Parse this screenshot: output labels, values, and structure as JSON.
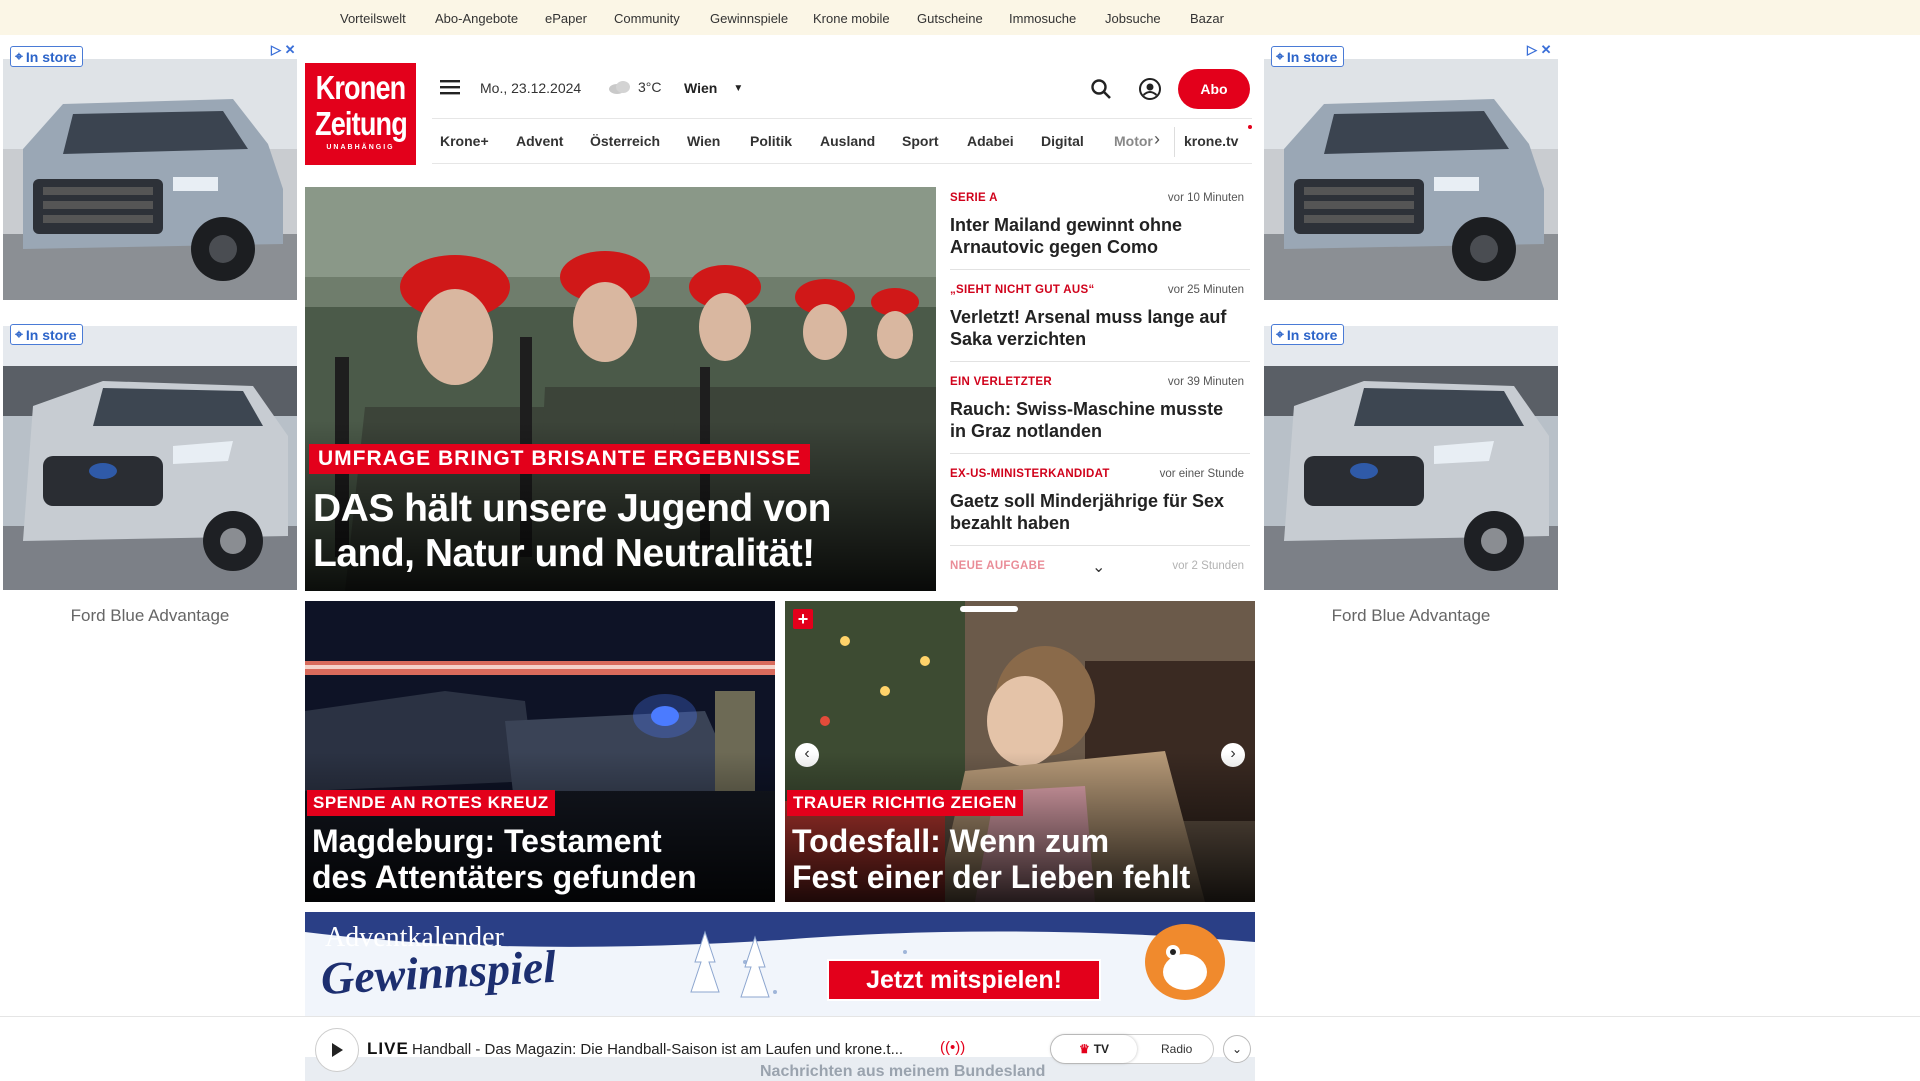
{
  "topnav": [
    "Vorteilswelt",
    "Abo-Angebote",
    "ePaper",
    "Community",
    "Gewinnspiele",
    "Krone mobile",
    "Gutscheine",
    "Immosuche",
    "Jobsuche",
    "Bazar"
  ],
  "ads": {
    "instore_label": "In store",
    "brand_left": "Ford Blue Advantage",
    "brand_right": "Ford Blue Advantage"
  },
  "logo": {
    "line1": "Kronen",
    "line2": "Zeitung",
    "tagline": "UNABHÄNGIG"
  },
  "header": {
    "date": "Mo., 23.12.2024",
    "temp": "3°C",
    "city": "Wien",
    "abo_label": "Abo"
  },
  "nav": [
    "Krone+",
    "Advent",
    "Österreich",
    "Wien",
    "Politik",
    "Ausland",
    "Sport",
    "Adabei",
    "Digital",
    "Motor"
  ],
  "nav_extra": "krone.tv",
  "hero": {
    "kicker": "UMFRAGE BRINGT BRISANTE ERGEBNISSE",
    "title_line1": "DAS hält unsere Jugend von",
    "title_line2": "Land, Natur und Neutralität!"
  },
  "ticker": [
    {
      "kicker": "SERIE A",
      "time": "vor 10 Minuten",
      "title": "Inter Mailand gewinnt ohne Arnautovic gegen Como"
    },
    {
      "kicker": "„SIEHT NICHT GUT AUS“",
      "time": "vor 25 Minuten",
      "title": "Verletzt! Arsenal muss lange auf Saka verzichten"
    },
    {
      "kicker": "EIN VERLETZTER",
      "time": "vor 39 Minuten",
      "title": "Rauch: Swiss-Maschine musste in Graz notlanden"
    },
    {
      "kicker": "EX-US-MINISTERKANDIDAT",
      "time": "vor einer Stunde",
      "title": "Gaetz soll Minderjährige für Sex bezahlt haben"
    },
    {
      "kicker": "NEUE AUFGABE",
      "time": "vor 2 Stunden",
      "title": ""
    }
  ],
  "card_left": {
    "kicker": "SPENDE AN ROTES KREUZ",
    "title_line1": "Magdeburg: Testament",
    "title_line2": "des Attentäters gefunden"
  },
  "card_right": {
    "kicker": "TRAUER RICHTIG ZEIGEN",
    "title_line1": "Todesfall: Wenn zum",
    "title_line2": "Fest einer der Lieben fehlt"
  },
  "banner": {
    "line1": "Adventkalender",
    "line2": "Gewinnspiel",
    "cta": "Jetzt mitspielen!"
  },
  "player": {
    "live": "LIVE",
    "track": "Handball - Das Magazin: Die Handball-Saison ist am Laufen und krone.t...",
    "tv": "TV",
    "radio": "Radio",
    "under": "Nachrichten aus meinem Bundesland"
  },
  "colors": {
    "brand_red": "#e3001b",
    "topbar_bg": "#fbf6e6",
    "ad_blue": "#2c64c9"
  }
}
